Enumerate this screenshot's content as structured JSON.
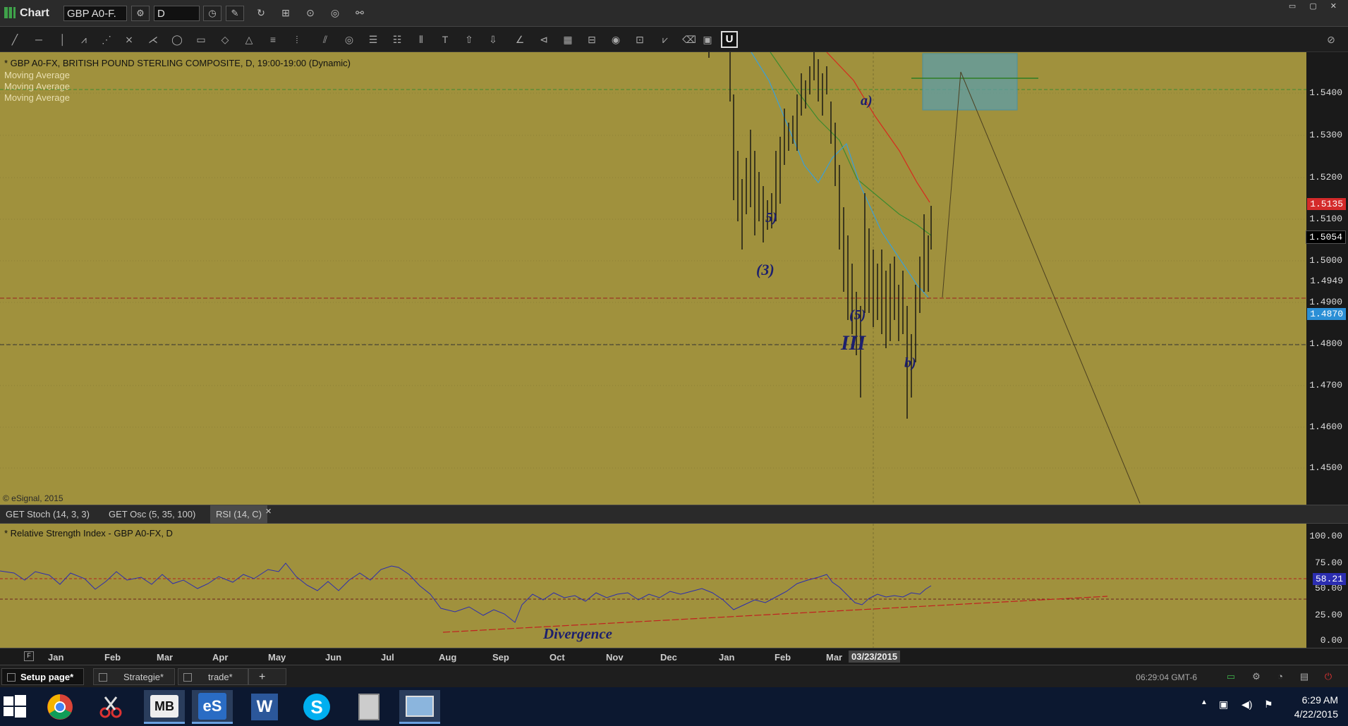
{
  "window": {
    "title": "Chart",
    "symbol_value": "GBP A0-F.",
    "interval_value": "D"
  },
  "chart": {
    "title_line": "* GBP A0-FX, BRITISH POUND STERLING COMPOSITE, D, 19:00-19:00 (Dynamic)",
    "ma_labels": [
      "Moving Average",
      "Moving Average",
      "Moving Average"
    ],
    "copyright": "© eSignal, 2015",
    "y_ticks": [
      "1.5400",
      "1.5300",
      "1.5200",
      "1.5100",
      "1.5000",
      "1.4900",
      "1.4800",
      "1.4700",
      "1.4600",
      "1.4500"
    ],
    "badges": [
      {
        "text": "1.5135",
        "bg": "#d42a2a",
        "fg": "#ffffff"
      },
      {
        "text": "1.5054",
        "bg": "#000000",
        "fg": "#ffffff"
      },
      {
        "text": "1.4949",
        "bg": "#1a1a1a",
        "fg": "#dddddd"
      },
      {
        "text": "1.4870",
        "bg": "#2b8fd6",
        "fg": "#ffffff"
      }
    ],
    "wave_labels": [
      "a)",
      "5)",
      "(3)",
      "(5)",
      "III",
      "b)"
    ]
  },
  "indicator_tabs": [
    "GET Stoch (14, 3, 3)",
    "GET Osc (5, 35, 100)",
    "RSI (14, C)"
  ],
  "rsi": {
    "title": "* Relative Strength Index - GBP A0-FX, D",
    "y_ticks": [
      "100.00",
      "75.00",
      "50.00",
      "25.00",
      "0.00"
    ],
    "value_badge": "58.21",
    "annotation": "Divergence"
  },
  "x_axis": {
    "labels": [
      "Jan",
      "Feb",
      "Mar",
      "Apr",
      "May",
      "Jun",
      "Jul",
      "Aug",
      "Sep",
      "Oct",
      "Nov",
      "Dec",
      "Jan",
      "Feb",
      "Mar"
    ],
    "cursor_date": "03/23/2015"
  },
  "pages": {
    "tabs": [
      "Setup page*",
      "Strategie*",
      "trade*"
    ],
    "add": "+",
    "status_time": "06:29:04 GMT-6"
  },
  "taskbar": {
    "time": "6:29 AM",
    "date": "4/22/2015"
  },
  "colors": {
    "chart_bg": "#a0913d",
    "ma_red": "#d62a1e",
    "ma_green": "#3c8a2e",
    "ma_blue": "#3a9fd8",
    "rsi_line": "#2b2db0"
  }
}
